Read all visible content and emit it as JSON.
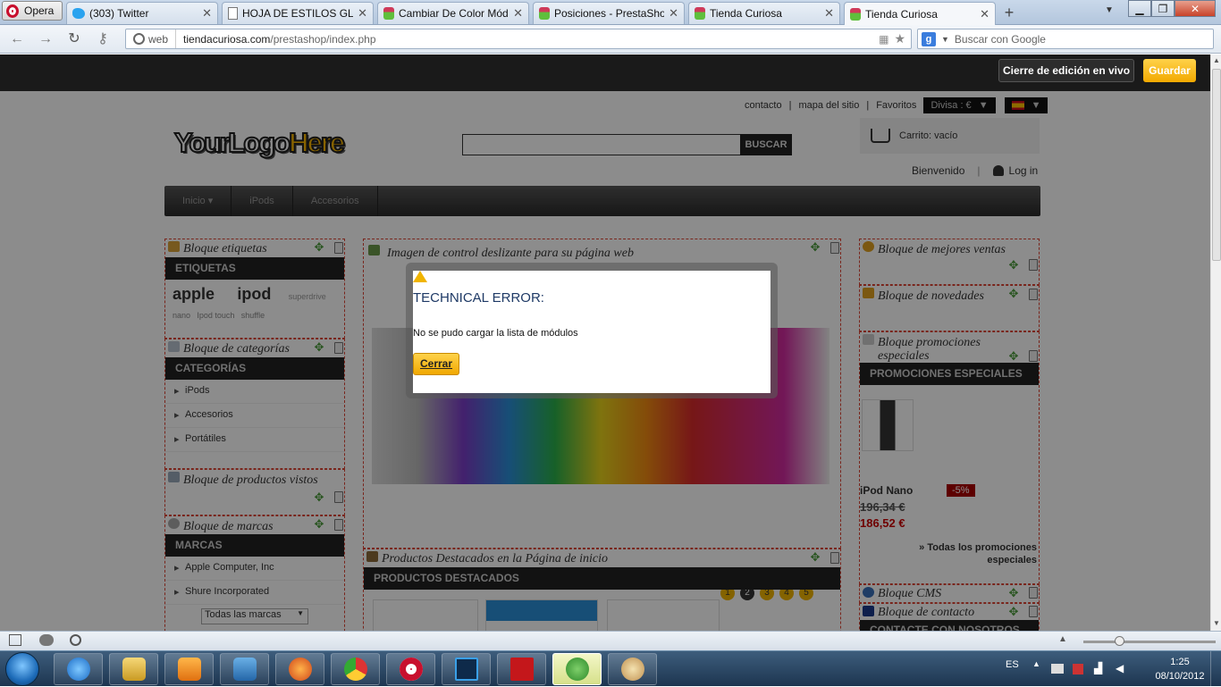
{
  "browser": {
    "opera_label": "Opera",
    "tabs": [
      {
        "title": "(303) Twitter"
      },
      {
        "title": "HOJA DE ESTILOS GLO..."
      },
      {
        "title": "Cambiar De Color Mód..."
      },
      {
        "title": "Posiciones - PrestaSho..."
      },
      {
        "title": "Tienda Curiosa"
      },
      {
        "title": "Tienda Curiosa"
      }
    ],
    "web_badge": "web",
    "url_domain": "tiendacuriosa.com",
    "url_path": "/prestashop/index.php",
    "search_placeholder": "Buscar con Google",
    "google_letter": "g"
  },
  "editbar": {
    "live_label": "Cierre de edición en vivo",
    "save_label": "Guardar"
  },
  "shop": {
    "toplinks": [
      "contacto",
      "mapa del sitio",
      "Favoritos"
    ],
    "separator": "|",
    "currency": "Divisa : €",
    "logo_part1": "YourLogo",
    "logo_part2": "Here",
    "search_button": "BUSCAR",
    "cart_text": "Carrito: vacío",
    "welcome": "Bienvenido",
    "login": "Log in",
    "menu": [
      "Inicio",
      "iPods",
      "Accesorios"
    ],
    "left": {
      "tags_title": "Bloque etiquetas",
      "tags_bar": "ETIQUETAS",
      "tags": {
        "apple": "apple",
        "ipod": "ipod",
        "superdrive": "superdrive",
        "nano": "nano",
        "ipod_touch": "Ipod touch",
        "shuffle": "shuffle"
      },
      "cat_title": "Bloque de categorías",
      "cat_bar": "CATEGORÍAS",
      "categories": [
        "iPods",
        "Accesorios",
        "Portátiles"
      ],
      "viewed_title": "Bloque de productos vistos",
      "brands_title": "Bloque de marcas",
      "brands_bar": "MARCAS",
      "brands": [
        "Apple Computer, Inc",
        "Shure Incorporated"
      ],
      "brands_select": "Todas las marcas"
    },
    "center": {
      "slider_title": "Imagen de control deslizante para su página web",
      "slider_dots": [
        "1",
        "2",
        "3",
        "4",
        "5"
      ],
      "featured_title": "Productos Destacados en la Página de inicio",
      "featured_bar": "PRODUCTOS DESTACADOS"
    },
    "right": {
      "best_title": "Bloque de mejores ventas",
      "new_title": "Bloque de novedades",
      "promo_title": "Bloque promociones especiales",
      "promo_bar": "PROMOCIONES ESPECIALES",
      "product_name": "iPod Nano",
      "discount": "-5%",
      "old_price": "196,34 €",
      "new_price": "186,52 €",
      "all_promos": "» Todas los promociones especiales",
      "cms_title": "Bloque CMS",
      "contact_title": "Bloque de contacto",
      "contact_bar": "CONTACTE CON NOSOTROS"
    }
  },
  "modal": {
    "title": "TECHNICAL ERROR:",
    "message": "No se pudo cargar la lista de módulos",
    "button": "Cerrar"
  },
  "taskbar": {
    "lang": "ES",
    "time": "1:25",
    "date": "08/10/2012"
  },
  "colors": {
    "accent": "#f0b400",
    "dark": "#222222",
    "error_title": "#1f3a66",
    "price_red": "#cc0000"
  }
}
